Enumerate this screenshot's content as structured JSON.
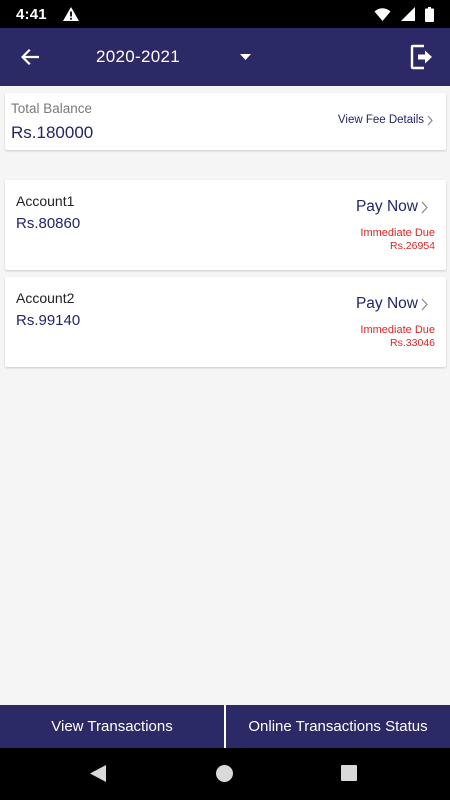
{
  "status_bar": {
    "time": "4:41"
  },
  "app_bar": {
    "year": "2020-2021"
  },
  "balance": {
    "label": "Total Balance",
    "value": "Rs.180000",
    "fee_link": "View Fee Details"
  },
  "accounts": [
    {
      "name": "Account1",
      "amount": "Rs.80860",
      "action": "Pay Now",
      "due_label": "Immediate Due",
      "due_amount": "Rs.26954"
    },
    {
      "name": "Account2",
      "amount": "Rs.99140",
      "action": "Pay Now",
      "due_label": "Immediate Due",
      "due_amount": "Rs.33046"
    }
  ],
  "bottom_bar": {
    "view_transactions": "View Transactions",
    "online_status": "Online Transactions Status"
  },
  "colors": {
    "primary": "#2b2a66",
    "text_navy": "#23246a",
    "due_red": "#e02424",
    "background": "#f5f5f5"
  },
  "icons": [
    "warning-icon",
    "wifi-icon",
    "signal-icon",
    "battery-icon",
    "back-arrow-icon",
    "dropdown-caret-icon",
    "logout-icon",
    "chevron-right-icon",
    "nav-back-icon",
    "nav-home-icon",
    "nav-recents-icon"
  ]
}
